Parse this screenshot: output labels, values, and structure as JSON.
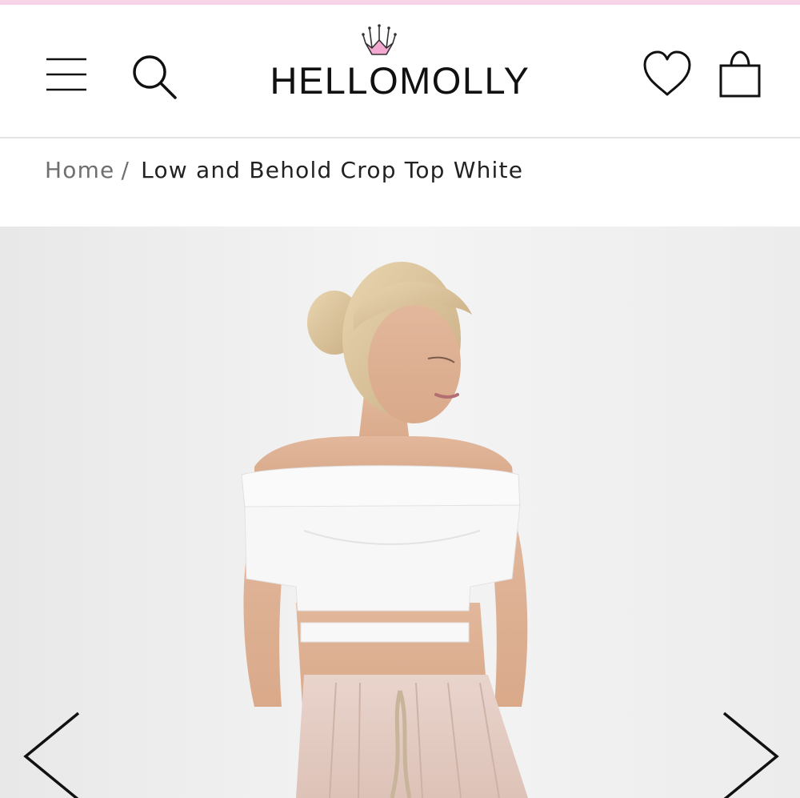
{
  "header": {
    "brand": "HELLOMOLLY",
    "icons": {
      "menu": "hamburger-menu-icon",
      "search": "search-icon",
      "wishlist": "heart-icon",
      "bag": "shopping-bag-icon",
      "crown": "crown-icon"
    }
  },
  "breadcrumb": {
    "home": "Home",
    "separator": "/",
    "current": "Low and Behold Crop Top White"
  },
  "gallery": {
    "prev_icon": "chevron-left-icon",
    "next_icon": "chevron-right-icon"
  },
  "colors": {
    "accent_strip": "#f6d3e6",
    "crown_pink": "#f3a9cf",
    "text_dark": "#222222",
    "text_muted": "#6f6f6f",
    "divider": "#e3e3e3"
  }
}
